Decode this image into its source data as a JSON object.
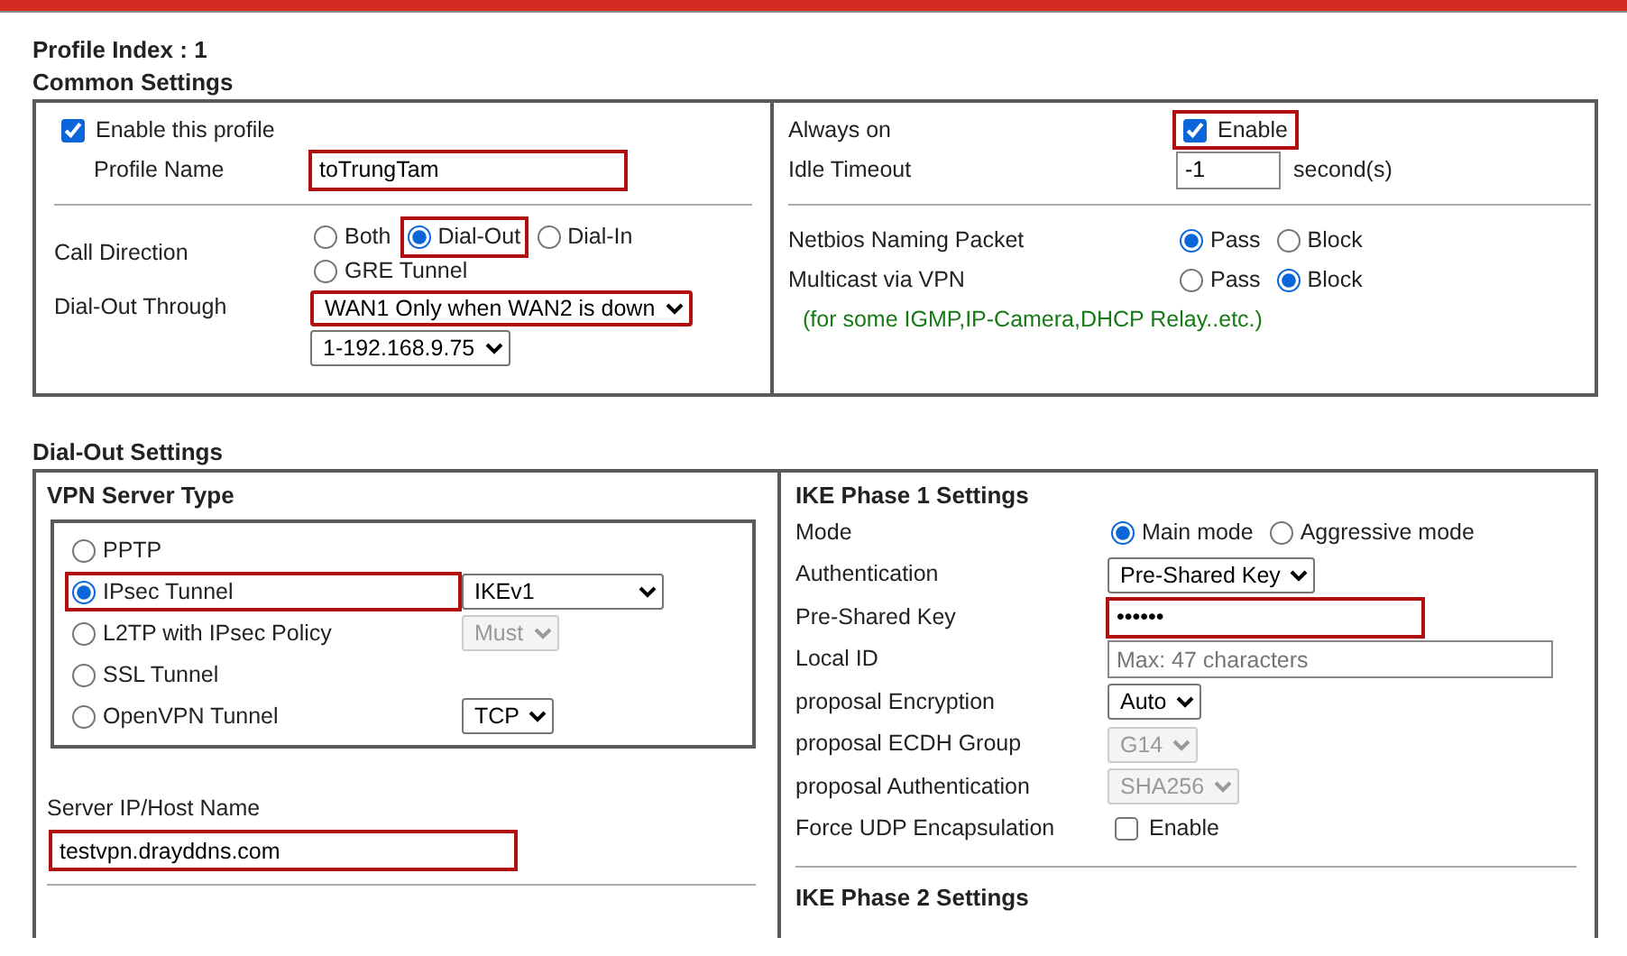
{
  "profile_index": "Profile Index : 1",
  "common": {
    "title": "Common Settings",
    "left": [
      {
        "kind": "checkbox",
        "option": "Enable this profile",
        "checked": true,
        "highlighted": false
      },
      {
        "kind": "text",
        "label": "Profile Name",
        "value": "toTrungTam",
        "highlighted": true
      },
      {
        "kind": "rule"
      },
      {
        "kind": "radio",
        "label": "Call Direction",
        "options": [
          {
            "label": "Both",
            "selected": false,
            "highlighted": false
          },
          {
            "label": "Dial-Out",
            "selected": true,
            "highlighted": true
          },
          {
            "label": "Dial-In",
            "selected": false,
            "highlighted": false
          },
          {
            "label": "GRE Tunnel",
            "selected": false,
            "highlighted": false
          }
        ]
      },
      {
        "kind": "select",
        "label": "Dial-Out Through",
        "value": "WAN1 Only when WAN2 is down",
        "disabled": false,
        "highlighted": true
      },
      {
        "kind": "select",
        "value": "1-192.168.9.75",
        "disabled": false,
        "highlighted": false
      }
    ],
    "right": [
      {
        "kind": "checkbox",
        "label": "Always on",
        "option": "Enable",
        "checked": true,
        "highlighted": true
      },
      {
        "kind": "text",
        "label": "Idle Timeout",
        "value": "-1",
        "unit": "second(s)",
        "highlighted": false
      },
      {
        "kind": "rule"
      },
      {
        "kind": "radio",
        "label": "Netbios Naming Packet",
        "options": [
          {
            "label": "Pass",
            "selected": true,
            "highlighted": false
          },
          {
            "label": "Block",
            "selected": false,
            "highlighted": false
          }
        ]
      },
      {
        "kind": "radio",
        "label": "Multicast via VPN",
        "options": [
          {
            "label": "Pass",
            "selected": false,
            "highlighted": false
          },
          {
            "label": "Block",
            "selected": true,
            "highlighted": false
          }
        ]
      },
      {
        "kind": "note",
        "text": "(for some IGMP,IP-Camera,DHCP Relay..etc.)"
      }
    ]
  },
  "dial_out": {
    "title": "Dial-Out Settings",
    "vpn_server_type": {
      "title": "VPN Server Type",
      "options": [
        {
          "label": "PPTP",
          "selected": false,
          "highlighted": false
        },
        {
          "label": "IPsec Tunnel",
          "selected": true,
          "highlighted": true,
          "select": {
            "value": "IKEv1",
            "disabled": false
          }
        },
        {
          "label": "L2TP with IPsec Policy",
          "selected": false,
          "highlighted": false,
          "select": {
            "value": "Must",
            "disabled": true
          }
        },
        {
          "label": "SSL Tunnel",
          "selected": false,
          "highlighted": false
        },
        {
          "label": "OpenVPN Tunnel",
          "selected": false,
          "highlighted": false,
          "select": {
            "value": "TCP",
            "disabled": false
          }
        }
      ]
    },
    "server_host": {
      "label": "Server IP/Host Name",
      "value": "testvpn.drayddns.com",
      "highlighted": true
    },
    "ike_phase1": {
      "title": "IKE Phase 1 Settings",
      "rows": [
        {
          "kind": "radio",
          "label": "Mode",
          "options": [
            {
              "label": "Main mode",
              "selected": true,
              "highlighted": false
            },
            {
              "label": "Aggressive mode",
              "selected": false,
              "highlighted": false
            }
          ]
        },
        {
          "kind": "select",
          "label": "Authentication",
          "value": "Pre-Shared Key",
          "disabled": false,
          "highlighted": false
        },
        {
          "kind": "text",
          "label": "Pre-Shared Key",
          "value": "••••••",
          "highlighted": true
        },
        {
          "kind": "text",
          "label": "Local ID",
          "placeholder": "Max: 47 characters",
          "highlighted": false
        },
        {
          "kind": "select",
          "label": "proposal Encryption",
          "value": "Auto",
          "disabled": false,
          "highlighted": false
        },
        {
          "kind": "select",
          "label": "proposal ECDH Group",
          "value": "G14",
          "disabled": true,
          "highlighted": false
        },
        {
          "kind": "select",
          "label": "proposal Authentication",
          "value": "SHA256",
          "disabled": true,
          "highlighted": false
        },
        {
          "kind": "checkbox",
          "label": "Force UDP Encapsulation",
          "option": "Enable",
          "checked": false,
          "highlighted": false
        }
      ]
    },
    "ike_phase2": {
      "title": "IKE Phase 2 Settings"
    }
  }
}
